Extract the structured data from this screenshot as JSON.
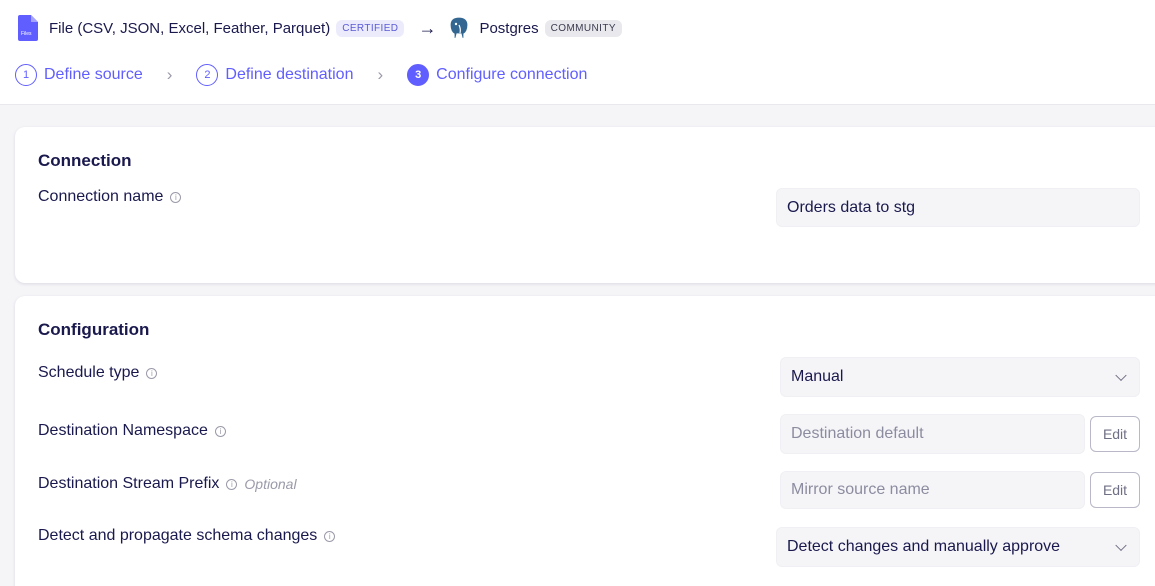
{
  "header": {
    "source": {
      "name": "File (CSV, JSON, Excel, Feather, Parquet)",
      "badge": "CERTIFIED",
      "icon": "file-icon"
    },
    "arrow": "→",
    "destination": {
      "name": "Postgres",
      "badge": "COMMUNITY",
      "icon": "postgres-elephant-icon"
    }
  },
  "steps": [
    {
      "number": "1",
      "label": "Define source"
    },
    {
      "number": "2",
      "label": "Define destination"
    },
    {
      "number": "3",
      "label": "Configure connection"
    }
  ],
  "connection_card": {
    "title": "Connection",
    "name_label": "Connection name",
    "name_value": "Orders data to stg"
  },
  "configuration_card": {
    "title": "Configuration",
    "schedule_type": {
      "label": "Schedule type",
      "value": "Manual"
    },
    "namespace": {
      "label": "Destination Namespace",
      "placeholder": "Destination default",
      "button": "Edit"
    },
    "stream_prefix": {
      "label": "Destination Stream Prefix",
      "optional": "Optional",
      "placeholder": "Mirror source name",
      "button": "Edit"
    },
    "schema_changes": {
      "label": "Detect and propagate schema changes",
      "value": "Detect changes and manually approve"
    }
  },
  "colors": {
    "accent": "#615eff",
    "text": "#1a194d",
    "muted": "#9a9aa9",
    "background": "#f5f5f8"
  }
}
